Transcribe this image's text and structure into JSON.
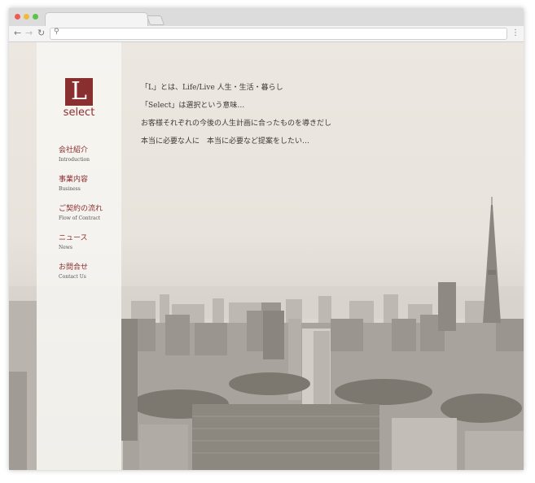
{
  "logo": {
    "letter": "L",
    "word": "select"
  },
  "nav": [
    {
      "jp": "会社紹介",
      "en": "Introduction"
    },
    {
      "jp": "事業内容",
      "en": "Business"
    },
    {
      "jp": "ご契約の流れ",
      "en": "Flow of Contract"
    },
    {
      "jp": "ニュース",
      "en": "News"
    },
    {
      "jp": "お問合せ",
      "en": "Contact Us"
    }
  ],
  "tagline": [
    "「L」とは、Life/Live 人生・生活・暮らし",
    "「Select」は選択という意味…",
    "お客様それぞれの今後の人生計画に合ったものを導きだし",
    "本当に必要な人に　本当に必要など提案をしたい…"
  ],
  "colors": {
    "accent": "#8a2f30",
    "text": "#3d3a37"
  }
}
